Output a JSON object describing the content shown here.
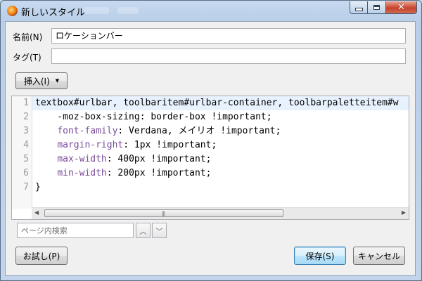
{
  "window": {
    "title": "新しいスタイル",
    "close_glyph": "✕"
  },
  "form": {
    "name_label": "名前(N)",
    "name_value": "ロケーションバー",
    "tag_label": "タグ(T)",
    "tag_value": ""
  },
  "toolbar": {
    "insert_label": "挿入(I)"
  },
  "editor": {
    "lines": [
      {
        "num": "1",
        "text": "textbox#urlbar, toolbaritem#urlbar-container, toolbarpaletteitem#w"
      },
      {
        "num": "2",
        "text": "    -moz-box-sizing: border-box !important;"
      },
      {
        "num": "3",
        "prop": "font-family",
        "rest": ": Verdana, メイリオ !important;"
      },
      {
        "num": "4",
        "prop": "margin-right",
        "rest": ": 1px !important;"
      },
      {
        "num": "5",
        "prop": "max-width",
        "rest": ": 400px !important;"
      },
      {
        "num": "6",
        "prop": "min-width",
        "rest": ": 200px !important;"
      },
      {
        "num": "7",
        "text": "}"
      }
    ]
  },
  "search": {
    "placeholder": "ページ内検索"
  },
  "footer": {
    "preview_label": "お試し(P)",
    "save_label": "保存(S)",
    "cancel_label": "キャンセル"
  },
  "colors": {
    "property": "#7a4c9a",
    "current_line": "#e8f2ff"
  }
}
